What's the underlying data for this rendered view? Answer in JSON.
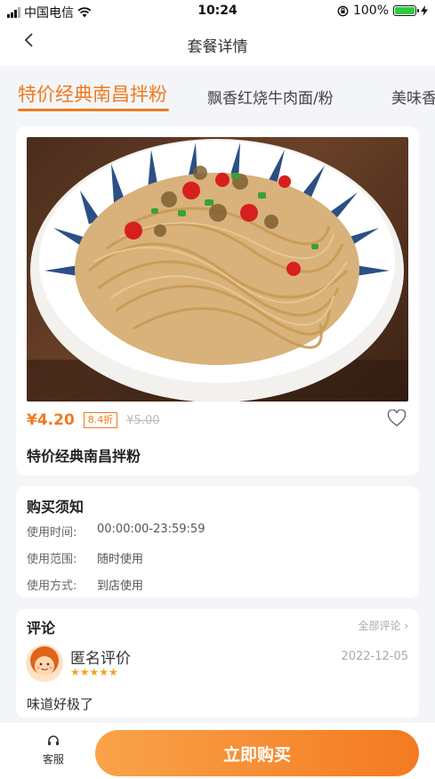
{
  "status_bar": {
    "carrier": "中国电信",
    "time": "10:24",
    "battery": "100%",
    "battery_level": 1.0
  },
  "nav": {
    "back_icon": "chevron-left-icon",
    "title": "套餐详情"
  },
  "tabs": [
    {
      "label": "特价经典南昌拌粉",
      "active": true
    },
    {
      "label": "飘香红烧牛肉面/粉",
      "active": false
    },
    {
      "label": "美味香",
      "active": false
    }
  ],
  "product": {
    "price": "¥4.20",
    "discount": "8.4折",
    "original_price": "¥5.00",
    "name": "特价经典南昌拌粉",
    "favorite_icon": "heart-icon"
  },
  "notice": {
    "title": "购买须知",
    "rows": [
      {
        "key": "使用时间:",
        "value": "00:00:00-23:59:59"
      },
      {
        "key": "使用范围:",
        "value": "随时使用"
      },
      {
        "key": "使用方式:",
        "value": "到店使用"
      }
    ]
  },
  "reviews": {
    "title": "评论",
    "all_link": "全部评论",
    "items": [
      {
        "reviewer": "匿名评价",
        "rating": 5,
        "stars": "★★★★★",
        "date": "2022-12-05",
        "text": "味道好极了"
      }
    ]
  },
  "bottom": {
    "service_label": "客服",
    "buy_label": "立即购买"
  },
  "colors": {
    "accent": "#f07a1e",
    "star": "#f5a21b"
  }
}
